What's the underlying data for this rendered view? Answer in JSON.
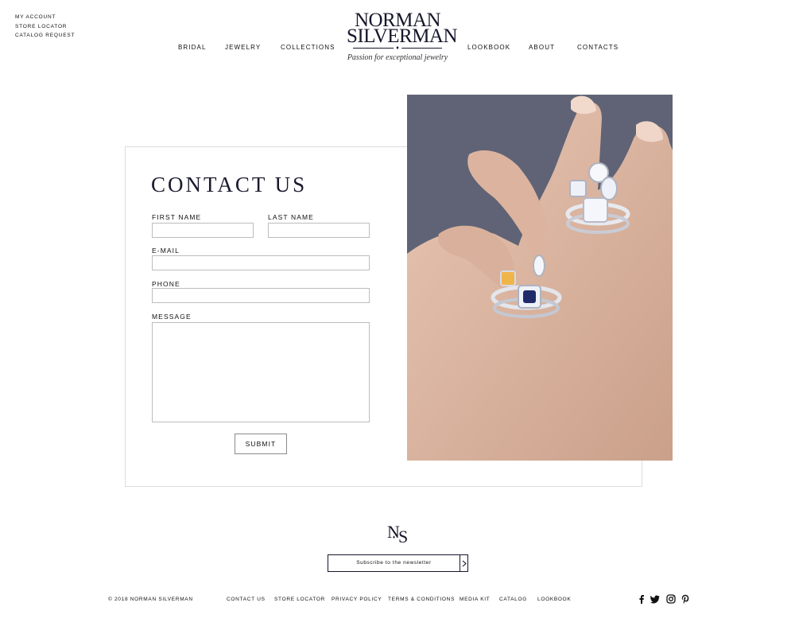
{
  "utility_links": [
    "MY ACCOUNT",
    "STORE LOCATOR",
    "CATALOG REQUEST"
  ],
  "logo": {
    "line1": "NORMAN",
    "line2": "SILVERMAN",
    "tagline": "Passion for exceptional jewelry"
  },
  "nav": {
    "bridal": "BRIDAL",
    "jewelry": "JEWELRY",
    "collections": "COLLECTIONS",
    "lookbook": "LOOKBOOK",
    "about": "ABOUT",
    "contacts": "CONTACTS"
  },
  "form": {
    "title": "CONTACT US",
    "first_name_label": "FIRST NAME",
    "first_name_value": "",
    "last_name_label": "LAST NAME",
    "last_name_value": "",
    "email_label": "E-MAIL",
    "email_value": "",
    "phone_label": "PHONE",
    "phone_value": "",
    "message_label": "MESSAGE",
    "message_value": "",
    "submit_label": "SUBMIT"
  },
  "footer": {
    "monogram": {
      "n": "N",
      "s": "S"
    },
    "newsletter_label": "Subscribe to the newsletter",
    "copyright": "© 2018 NORMAN SILVERMAN",
    "links": {
      "contact_us": "CONTACT US",
      "store_locator": "STORE LOCATOR",
      "privacy_policy": "PRIVACY POLICY",
      "terms": "TERMS & CONDITIONS",
      "media_kit": "MEDIA KIT",
      "catalog": "CATALOG",
      "lookbook": "LOOKBOOK"
    },
    "social_icons": [
      "facebook-icon",
      "twitter-icon",
      "instagram-icon",
      "pinterest-icon"
    ]
  },
  "colors": {
    "brand_navy": "#16162a",
    "photo_background": "#5f6375",
    "border": "#dcdcdc"
  }
}
